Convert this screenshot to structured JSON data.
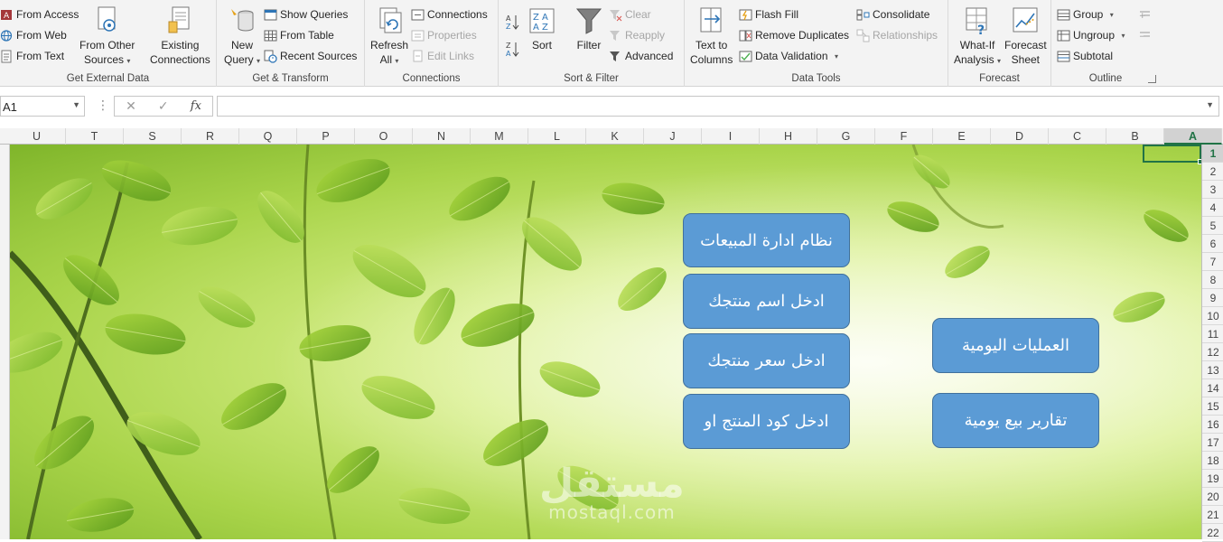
{
  "ribbon": {
    "get_external_data": {
      "label": "Get External Data",
      "from_access": "From Access",
      "from_web": "From Web",
      "from_text": "From Text",
      "from_other_sources_1": "From Other",
      "from_other_sources_2": "Sources",
      "existing_connections_1": "Existing",
      "existing_connections_2": "Connections"
    },
    "get_transform": {
      "label": "Get & Transform",
      "new_query_1": "New",
      "new_query_2": "Query",
      "show_queries": "Show Queries",
      "from_table": "From Table",
      "recent_sources": "Recent Sources"
    },
    "connections": {
      "label": "Connections",
      "refresh_all_1": "Refresh",
      "refresh_all_2": "All",
      "connections": "Connections",
      "properties": "Properties",
      "edit_links": "Edit Links"
    },
    "sort_filter": {
      "label": "Sort & Filter",
      "sort": "Sort",
      "filter": "Filter",
      "clear": "Clear",
      "reapply": "Reapply",
      "advanced": "Advanced"
    },
    "data_tools": {
      "label": "Data Tools",
      "text_to_columns_1": "Text to",
      "text_to_columns_2": "Columns",
      "flash_fill": "Flash Fill",
      "remove_duplicates": "Remove Duplicates",
      "data_validation": "Data Validation",
      "consolidate": "Consolidate",
      "relationships": "Relationships"
    },
    "forecast": {
      "label": "Forecast",
      "what_if_1": "What-If",
      "what_if_2": "Analysis",
      "forecast_sheet_1": "Forecast",
      "forecast_sheet_2": "Sheet"
    },
    "outline": {
      "label": "Outline",
      "group": "Group",
      "ungroup": "Ungroup",
      "subtotal": "Subtotal"
    }
  },
  "formula_bar": {
    "name_box": "A1",
    "cancel": "✕",
    "enter": "✓",
    "fx": "fx",
    "value": ""
  },
  "sheet": {
    "columns": [
      "U",
      "T",
      "S",
      "R",
      "Q",
      "P",
      "O",
      "N",
      "M",
      "L",
      "K",
      "J",
      "I",
      "H",
      "G",
      "F",
      "E",
      "D",
      "C",
      "B",
      "A"
    ],
    "rows": [
      "1",
      "2",
      "3",
      "4",
      "5",
      "6",
      "7",
      "8",
      "9",
      "10",
      "11",
      "12",
      "13",
      "14",
      "15",
      "16",
      "17",
      "18",
      "19",
      "20",
      "21",
      "22"
    ],
    "active_cell": "A1"
  },
  "buttons": {
    "sales_system": "نظام ادارة المبيعات",
    "enter_product_name": "ادخل اسم منتجك",
    "enter_product_price": "ادخل سعر منتجك",
    "enter_product_code": "ادخل كود المنتج او",
    "daily_operations": "العمليات اليومية",
    "daily_sales_reports": "تقارير بيع يومية"
  },
  "watermark": {
    "arabic": "مستقل",
    "latin": "mostaql.com"
  }
}
